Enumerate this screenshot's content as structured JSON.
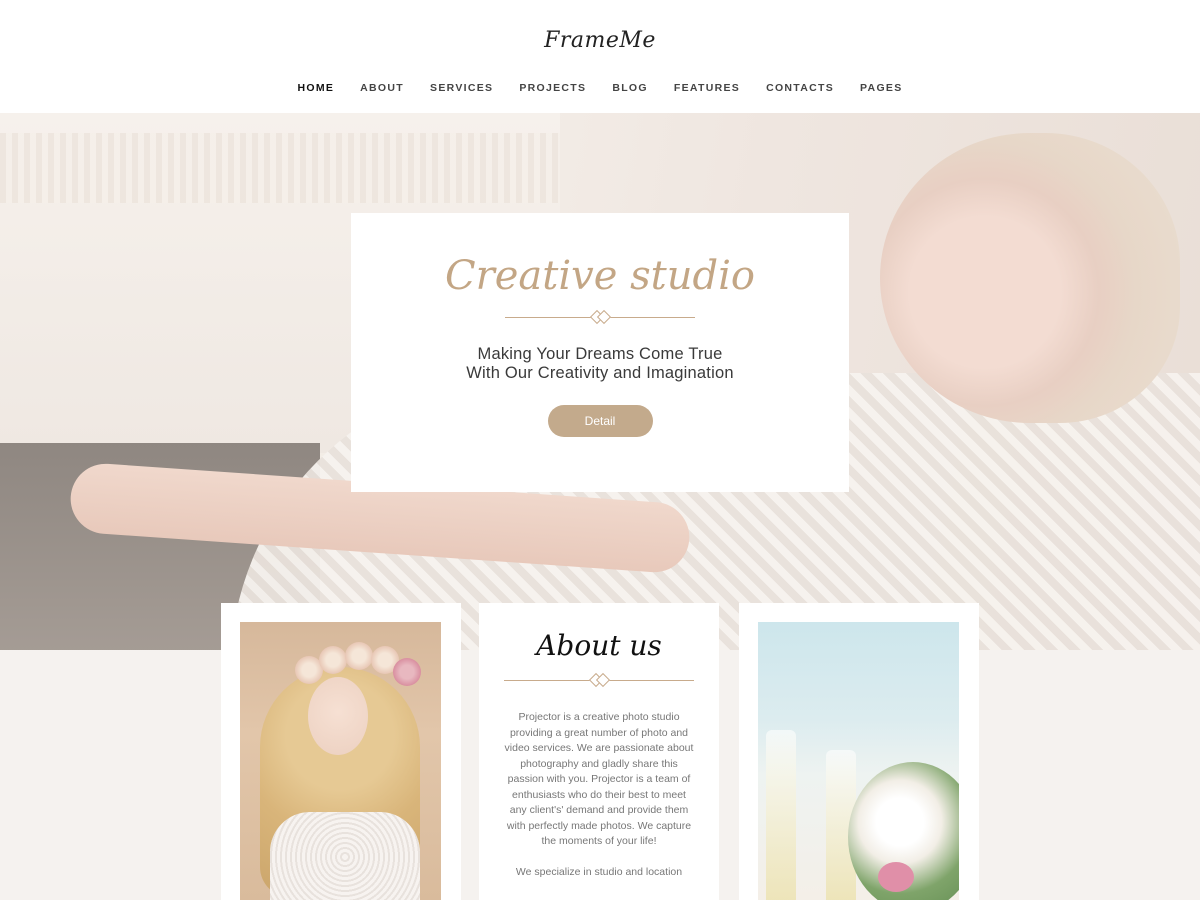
{
  "header": {
    "logo": "FrameMe",
    "nav": [
      {
        "label": "HOME",
        "active": true
      },
      {
        "label": "ABOUT"
      },
      {
        "label": "SERVICES"
      },
      {
        "label": "PROJECTS"
      },
      {
        "label": "BLOG"
      },
      {
        "label": "FEATURES"
      },
      {
        "label": "CONTACTS"
      },
      {
        "label": "PAGES"
      }
    ]
  },
  "hero": {
    "title": "Creative studio",
    "subtitle_line1": "Making Your Dreams Come True",
    "subtitle_line2": "With Our Creativity and Imagination",
    "button_label": "Detail"
  },
  "about": {
    "title": "About us",
    "paragraph1": "Projector is a creative photo studio providing a great number of photo and video services. We are passionate about photography and gladly share this passion with you. Projector is a team of enthusiasts who do their best to meet any client's' demand and provide them with perfectly made photos. We capture the moments of your life!",
    "paragraph2": "We specialize in studio and location"
  },
  "colors": {
    "accent": "#c3aa8c",
    "background_lower": "#f5f2ef"
  }
}
